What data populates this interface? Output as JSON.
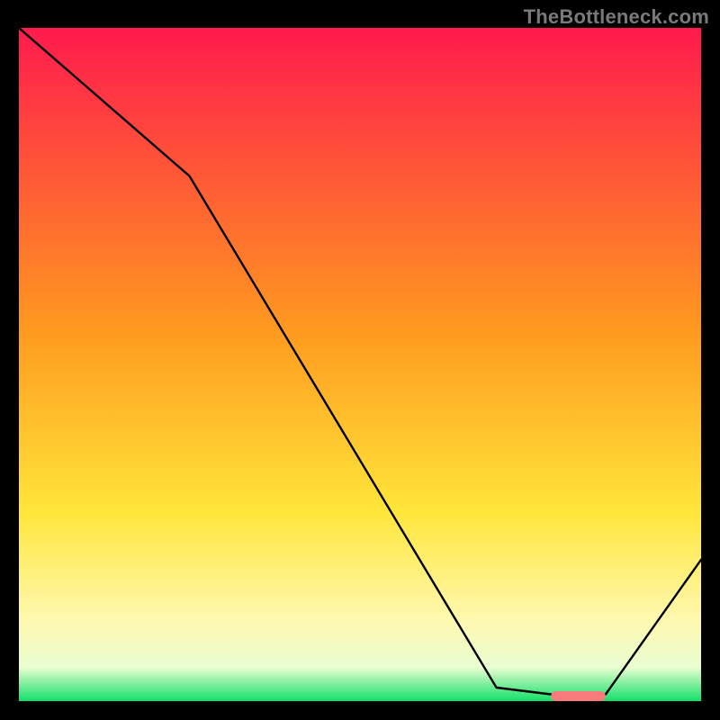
{
  "watermark": "TheBottleneck.com",
  "chart_data": {
    "type": "line",
    "title": "",
    "xlabel": "",
    "ylabel": "",
    "xlim": [
      0,
      100
    ],
    "ylim": [
      0,
      100
    ],
    "gradient_stops": [
      {
        "offset": 0,
        "color": "#ff1a4d"
      },
      {
        "offset": 0.45,
        "color": "#ff9a1f"
      },
      {
        "offset": 0.72,
        "color": "#ffe63a"
      },
      {
        "offset": 0.88,
        "color": "#fff8b0"
      },
      {
        "offset": 0.95,
        "color": "#e9fdd0"
      },
      {
        "offset": 1.0,
        "color": "#12e06a"
      }
    ],
    "series": [
      {
        "name": "bottleneck-curve",
        "x": [
          0,
          25,
          70,
          78,
          86,
          100
        ],
        "y": [
          100,
          78,
          2,
          1,
          1,
          21
        ]
      }
    ],
    "marker": {
      "x_start": 78,
      "x_end": 86,
      "y": 0.8,
      "color": "#f97a7a"
    }
  }
}
